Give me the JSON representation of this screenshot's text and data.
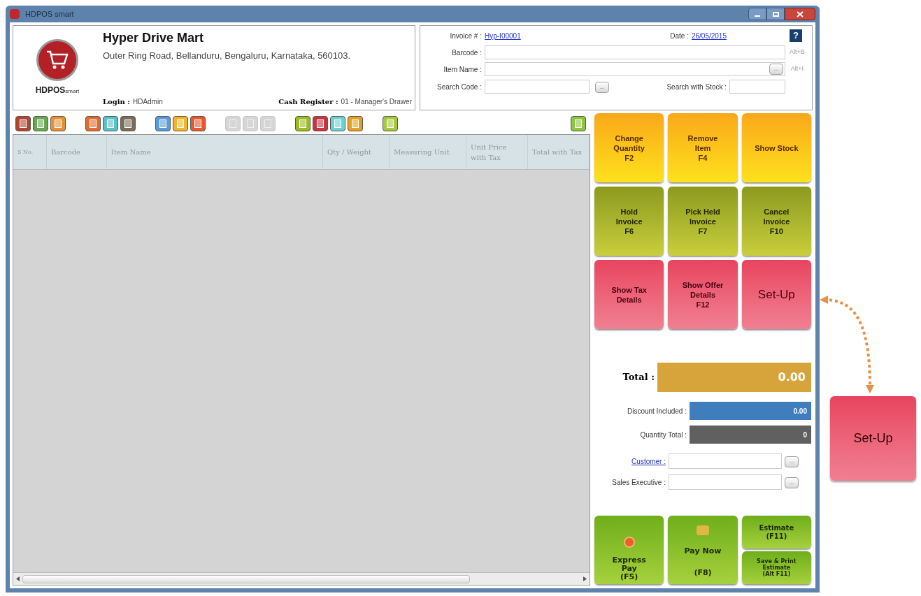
{
  "window": {
    "title": "HDPOS smart"
  },
  "store": {
    "logo_text": "HDPOS",
    "logo_small": "smart",
    "name": "Hyper Drive Mart",
    "address": "Outer Ring Road, Bellanduru, Bengaluru, Karnataka, 560103.",
    "login_label": "Login :",
    "login_value": "HDAdmin",
    "register_label": "Cash Register :",
    "register_value": "01 - Manager's Drawer"
  },
  "invoice": {
    "invoice_label": "Invoice # :",
    "invoice_value": "Hyp-I00001",
    "date_label": "Date :",
    "date_value": "26/05/2015",
    "help": "?",
    "barcode_label": "Barcode :",
    "barcode_shortcut": "Alt+B",
    "item_label": "Item Name :",
    "item_shortcut": "Alt+I",
    "search_code_label": "Search Code :",
    "search_stock_label": "Search with Stock :",
    "browse": "..."
  },
  "toolbar": [
    {
      "buttons": [
        {
          "color": "#b0452e",
          "disabled": false
        },
        {
          "color": "#6aa84f",
          "disabled": false
        },
        {
          "color": "#e69138",
          "disabled": false
        }
      ]
    },
    {
      "buttons": [
        {
          "color": "#e06c2e",
          "disabled": false
        },
        {
          "color": "#5bc0c8",
          "disabled": false
        },
        {
          "color": "#7d6b5a",
          "disabled": false
        }
      ]
    },
    {
      "buttons": [
        {
          "color": "#5b9bd5",
          "disabled": false
        },
        {
          "color": "#f1b52b",
          "disabled": false
        },
        {
          "color": "#e8582c",
          "disabled": false
        }
      ]
    },
    {
      "buttons": [
        {
          "color": "#d6d6d6",
          "disabled": true
        },
        {
          "color": "#d6d6d6",
          "disabled": true
        },
        {
          "color": "#d6d6d6",
          "disabled": true
        }
      ]
    },
    {
      "buttons": [
        {
          "color": "#9bbb1f",
          "disabled": false
        },
        {
          "color": "#c9343f",
          "disabled": false
        },
        {
          "color": "#6fd0d0",
          "disabled": false
        },
        {
          "color": "#e6a020",
          "disabled": false
        }
      ]
    },
    {
      "buttons": [
        {
          "color": "#a5c93a",
          "disabled": false
        }
      ]
    },
    {
      "buttons": [
        {
          "color": "#8cc63f",
          "disabled": false
        }
      ]
    }
  ],
  "table": {
    "columns": [
      "S No.",
      "Barcode",
      "Item Name",
      "Qty / Weight",
      "Measuring Unit",
      "Unit Price with Tax",
      "Total with Tax"
    ]
  },
  "actions": [
    {
      "kind": "orange",
      "label": "Change\nQuantity\nF2"
    },
    {
      "kind": "orange",
      "label": "Remove\nItem\nF4"
    },
    {
      "kind": "orange",
      "label": "Show Stock"
    },
    {
      "kind": "olive",
      "label": "Hold\nInvoice\nF6"
    },
    {
      "kind": "olive",
      "label": "Pick Held\nInvoice\nF7"
    },
    {
      "kind": "olive",
      "label": "Cancel\nInvoice\nF10"
    },
    {
      "kind": "pink",
      "label": "Show Tax\nDetails"
    },
    {
      "kind": "pink",
      "label": "Show Offer\nDetails\nF12"
    },
    {
      "kind": "pink-large",
      "label": "Set-Up"
    }
  ],
  "totals": {
    "total_label": "Total :",
    "total_value": "0.00",
    "discount_label": "Discount Included :",
    "discount_value": "0.00",
    "quantity_label": "Quantity Total :",
    "quantity_value": "0"
  },
  "customer": {
    "customer_label": "Customer :",
    "sales_label": "Sales Executive :",
    "browse": "..."
  },
  "payment": {
    "express": "Express\nPay\n(F5)",
    "pay_now": "Pay Now",
    "pay_now_key": "(F8)",
    "estimate": "Estimate\n(F11)",
    "save_print": "Save & Print\nEstimate\n(Alt F11)"
  },
  "callout": {
    "label": "Set-Up"
  }
}
